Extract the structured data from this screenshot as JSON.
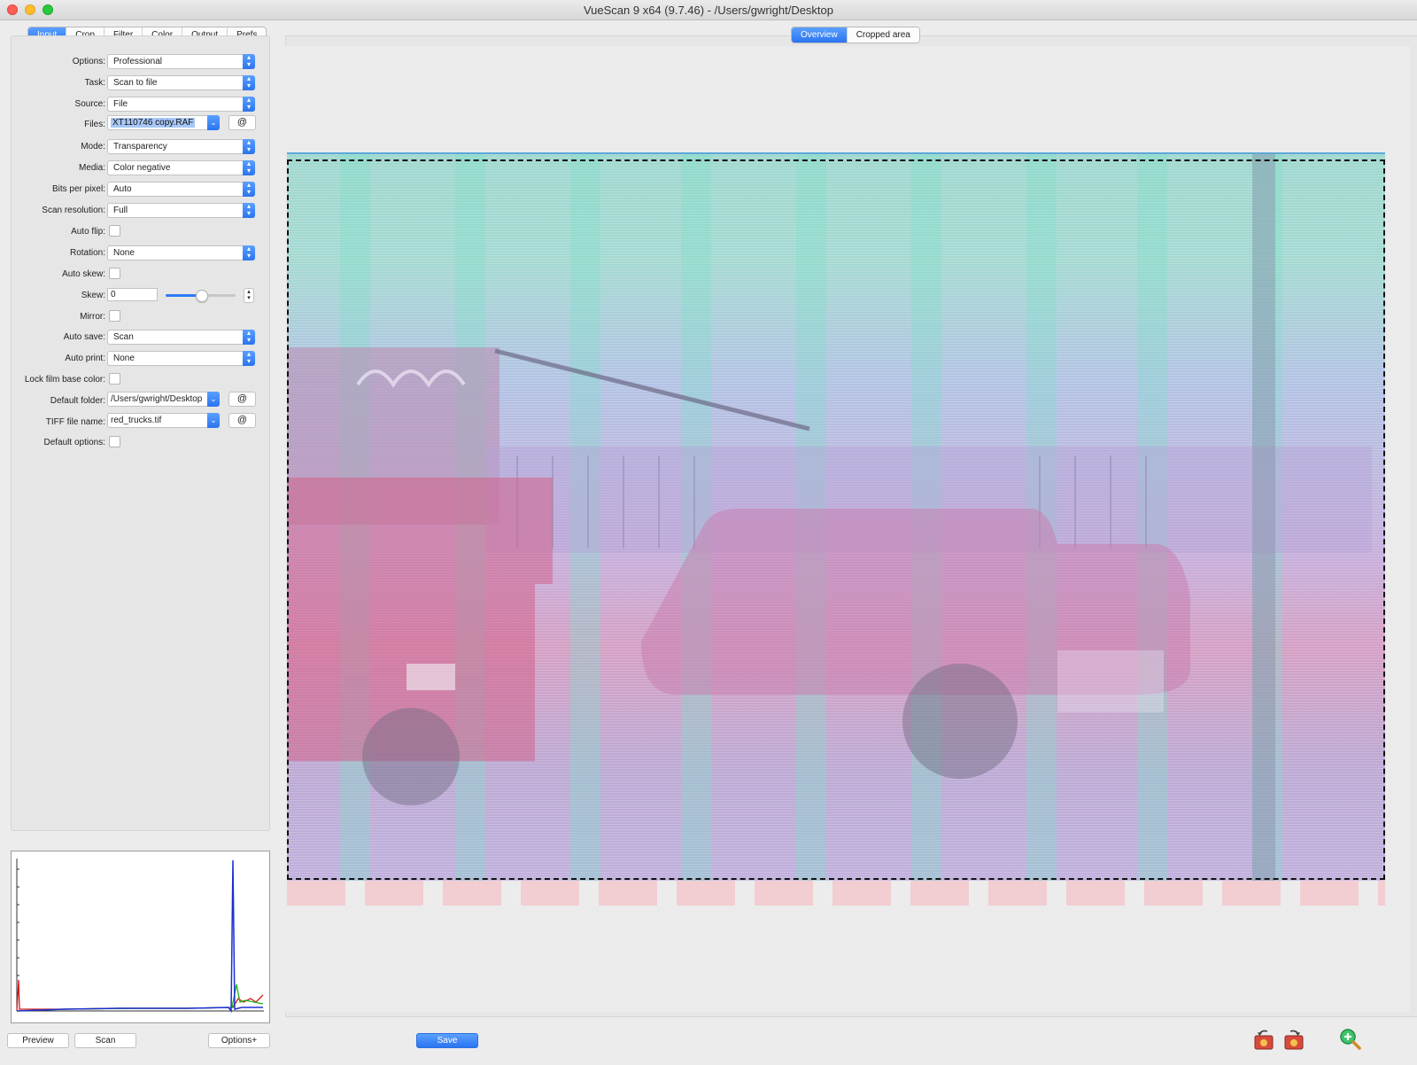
{
  "window": {
    "title": "VueScan 9 x64 (9.7.46) - /Users/gwright/Desktop"
  },
  "left_tabs": [
    {
      "label": "Input",
      "active": true
    },
    {
      "label": "Crop",
      "active": false
    },
    {
      "label": "Filter",
      "active": false
    },
    {
      "label": "Color",
      "active": false
    },
    {
      "label": "Output",
      "active": false
    },
    {
      "label": "Prefs",
      "active": false
    }
  ],
  "right_tabs": [
    {
      "label": "Overview",
      "active": true
    },
    {
      "label": "Cropped area",
      "active": false
    }
  ],
  "input": {
    "options": {
      "label": "Options:",
      "value": "Professional"
    },
    "task": {
      "label": "Task:",
      "value": "Scan to file"
    },
    "source": {
      "label": "Source:",
      "value": "File"
    },
    "files": {
      "label": "Files:",
      "value": "XT110746 copy.RAF",
      "at": "@"
    },
    "mode": {
      "label": "Mode:",
      "value": "Transparency"
    },
    "media": {
      "label": "Media:",
      "value": "Color negative"
    },
    "bits_per_pixel": {
      "label": "Bits per pixel:",
      "value": "Auto"
    },
    "scan_resolution": {
      "label": "Scan resolution:",
      "value": "Full"
    },
    "auto_flip": {
      "label": "Auto flip:",
      "checked": false
    },
    "rotation": {
      "label": "Rotation:",
      "value": "None"
    },
    "auto_skew": {
      "label": "Auto skew:",
      "checked": false
    },
    "skew": {
      "label": "Skew:",
      "value": "0",
      "slider_fraction": 0.5
    },
    "mirror": {
      "label": "Mirror:",
      "checked": false
    },
    "auto_save": {
      "label": "Auto save:",
      "value": "Scan"
    },
    "auto_print": {
      "label": "Auto print:",
      "value": "None"
    },
    "lock_film_base_color": {
      "label": "Lock film base color:",
      "checked": false
    },
    "default_folder": {
      "label": "Default folder:",
      "value": "/Users/gwright/Desktop",
      "at": "@"
    },
    "tiff_file_name": {
      "label": "TIFF file name:",
      "value": "red_trucks.tif",
      "at": "@"
    },
    "default_options": {
      "label": "Default options:",
      "checked": false
    }
  },
  "bottom_buttons": {
    "preview": "Preview",
    "scan": "Scan",
    "options_plus": "Options+",
    "save": "Save"
  },
  "icons": {
    "rotate_left": "rotate-left-icon",
    "rotate_right": "rotate-right-icon",
    "zoom_in": "zoom-in-icon"
  },
  "colors": {
    "accent": "#2a74f0",
    "histogram_blue": "#1c2fd0",
    "histogram_green": "#1bb51b",
    "histogram_red": "#d01c1c"
  }
}
